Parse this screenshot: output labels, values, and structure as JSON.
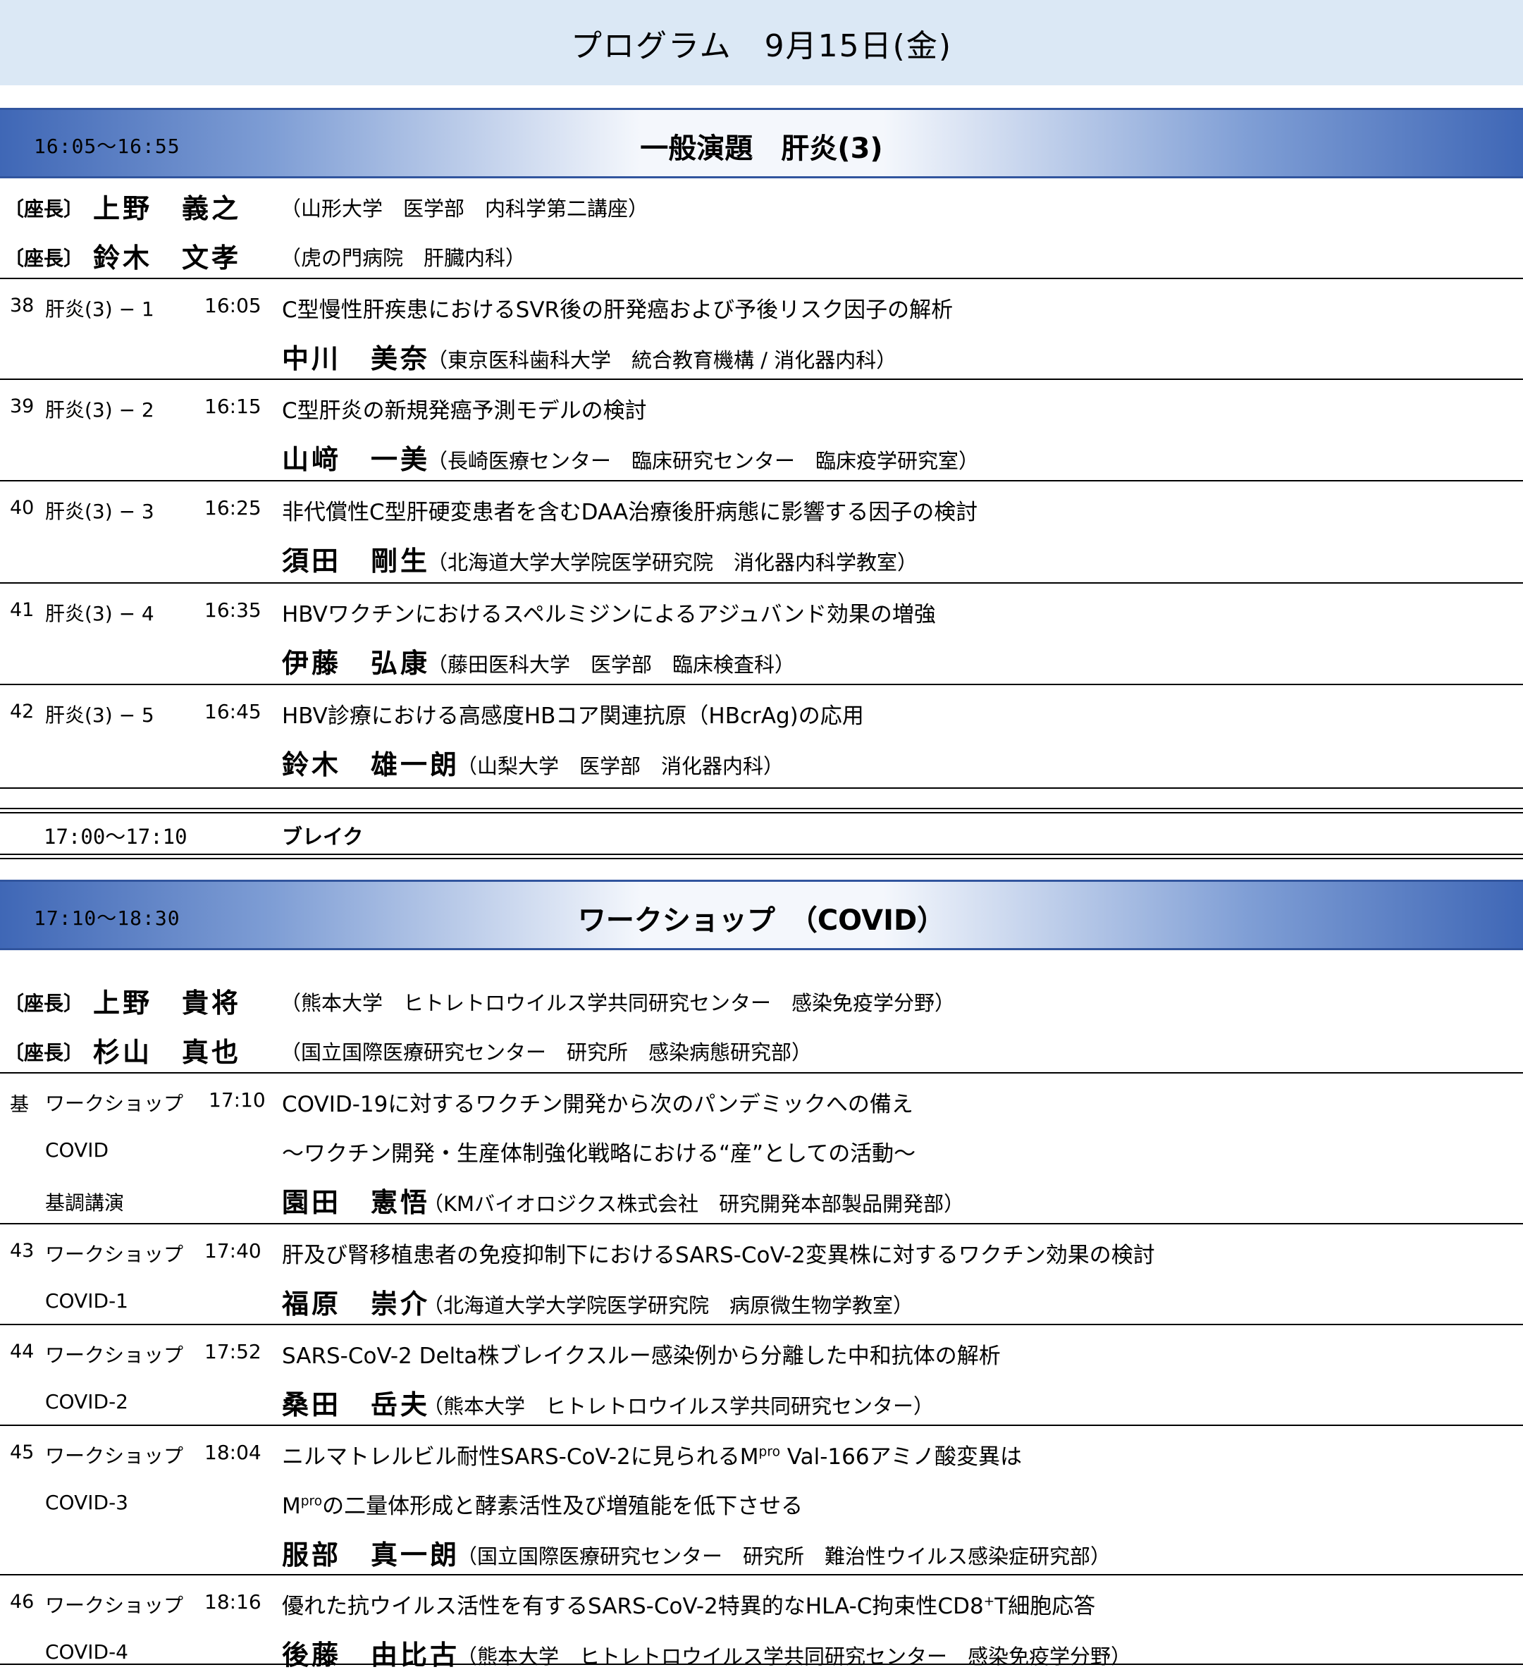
{
  "header": {
    "title": "プログラム　9月15日(金)"
  },
  "sessions": [
    {
      "time": "16:05〜16:55",
      "title": "一般演題　肝炎(3)",
      "chairs": [
        {
          "tag": "〔座長〕",
          "name": "上野　義之",
          "aff": "（山形大学　医学部　内科学第二講座）"
        },
        {
          "tag": "〔座長〕",
          "name": "鈴木　文孝",
          "aff": "（虎の門病院　肝臓内科）"
        }
      ],
      "items": [
        {
          "no": "38",
          "cat": "肝炎(3) − 1",
          "time": "16:05",
          "title": "C型慢性肝疾患におけるSVR後の肝発癌および予後リスク因子の解析",
          "name": "中川　美奈",
          "aff": "（東京医科歯科大学　統合教育機構 / 消化器内科）"
        },
        {
          "no": "39",
          "cat": "肝炎(3) − 2",
          "time": "16:15",
          "title": "C型肝炎の新規発癌予測モデルの検討",
          "name": "山﨑　一美",
          "aff": "（長崎医療センター　臨床研究センター　臨床疫学研究室）"
        },
        {
          "no": "40",
          "cat": "肝炎(3) − 3",
          "time": "16:25",
          "title": "非代償性C型肝硬変患者を含むDAA治療後肝病態に影響する因子の検討",
          "name": "須田　剛生",
          "aff": "（北海道大学大学院医学研究院　消化器内科学教室）"
        },
        {
          "no": "41",
          "cat": "肝炎(3) − 4",
          "time": "16:35",
          "title": "HBVワクチンにおけるスペルミジンによるアジュバンド効果の増強",
          "name": "伊藤　弘康",
          "aff": "（藤田医科大学　医学部　臨床検査科）"
        },
        {
          "no": "42",
          "cat": "肝炎(3) − 5",
          "time": "16:45",
          "title": "HBV診療における高感度HBコア関連抗原（HBcrAg)の応用",
          "name": "鈴木　雄一朗",
          "aff": "（山梨大学　医学部　消化器内科）"
        }
      ]
    },
    {
      "time": "17:10〜18:30",
      "title": "ワークショップ　（COVID）",
      "chairs": [
        {
          "tag": "〔座長〕",
          "name": "上野　貴将",
          "aff": "（熊本大学　ヒトレトロウイルス学共同研究センター　感染免疫学分野）"
        },
        {
          "tag": "〔座長〕",
          "name": "杉山　真也",
          "aff": "（国立国際医療研究センター　研究所　感染病態研究部）"
        }
      ],
      "keynote": {
        "no": "基",
        "cat": "ワークショップ",
        "sub1": "COVID",
        "sub2": "基調講演",
        "time": "17:10",
        "title": "COVID-19に対するワクチン開発から次のパンデミックへの備え",
        "subtitle": "〜ワクチン開発・生産体制強化戦略における“産”としての活動〜",
        "name": "園田　憲悟",
        "aff": "（KMバイオロジクス株式会社　研究開発本部製品開発部）"
      },
      "items": [
        {
          "no": "43",
          "cat": "ワークショップ",
          "sub": "COVID-1",
          "time": "17:40",
          "title": "肝及び腎移植患者の免疫抑制下におけるSARS-CoV-2変異株に対するワクチン効果の検討",
          "name": "福原　崇介",
          "aff": "（北海道大学大学院医学研究院　病原微生物学教室）"
        },
        {
          "no": "44",
          "cat": "ワークショップ",
          "sub": "COVID-2",
          "time": "17:52",
          "title": "SARS-CoV-2 Delta株ブレイクスルー感染例から分離した中和抗体の解析",
          "name": "桑田　岳夫",
          "aff": "（熊本大学　ヒトレトロウイルス学共同研究センター）"
        },
        {
          "no": "45",
          "cat": "ワークショップ",
          "sub": "COVID-3",
          "time": "18:04",
          "title_a": "ニルマトレルビル耐性SARS-CoV-2に見られるM",
          "title_sup": "pro",
          "title_b": " Val-166アミノ酸変異は",
          "title2_a": "M",
          "title2_sup": "pro",
          "title2_b": "の二量体形成と酵素活性及び増殖能を低下させる",
          "name": "服部　真一朗",
          "aff": "（国立国際医療研究センター　研究所　難治性ウイルス感染症研究部）"
        },
        {
          "no": "46",
          "cat": "ワークショップ",
          "sub": "COVID-4",
          "time": "18:16",
          "title_a": "優れた抗ウイルス活性を有するSARS-CoV-2特異的なHLA-C拘束性CD8",
          "title_sup": "+",
          "title_b": "T細胞応答",
          "name": "後藤　由比古",
          "aff": "（熊本大学　ヒトレトロウイルス学共同研究センター　感染免疫学分野）"
        }
      ]
    }
  ],
  "break": {
    "time": "17:00〜17:10",
    "label": "ブレイク"
  }
}
